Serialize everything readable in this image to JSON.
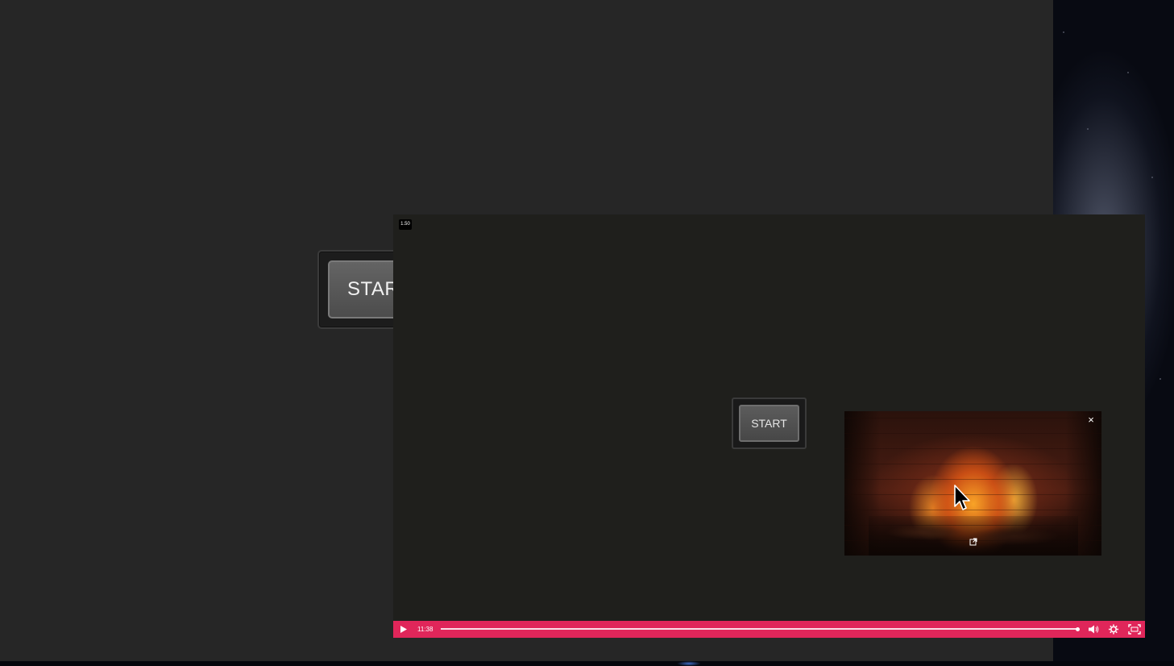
{
  "background_app": {
    "start_button_label": "START"
  },
  "video_player": {
    "speed_badge": "1.50",
    "inner_start_button_label": "START",
    "pip": {
      "close_label": "×"
    },
    "controls": {
      "time": "11:38",
      "progress": 1.0
    },
    "accent_color": "#e0265a"
  },
  "icons": [
    "play-icon",
    "volume-icon",
    "settings-icon",
    "fullscreen-icon",
    "close-icon",
    "popout-icon",
    "mouse-cursor-icon"
  ]
}
